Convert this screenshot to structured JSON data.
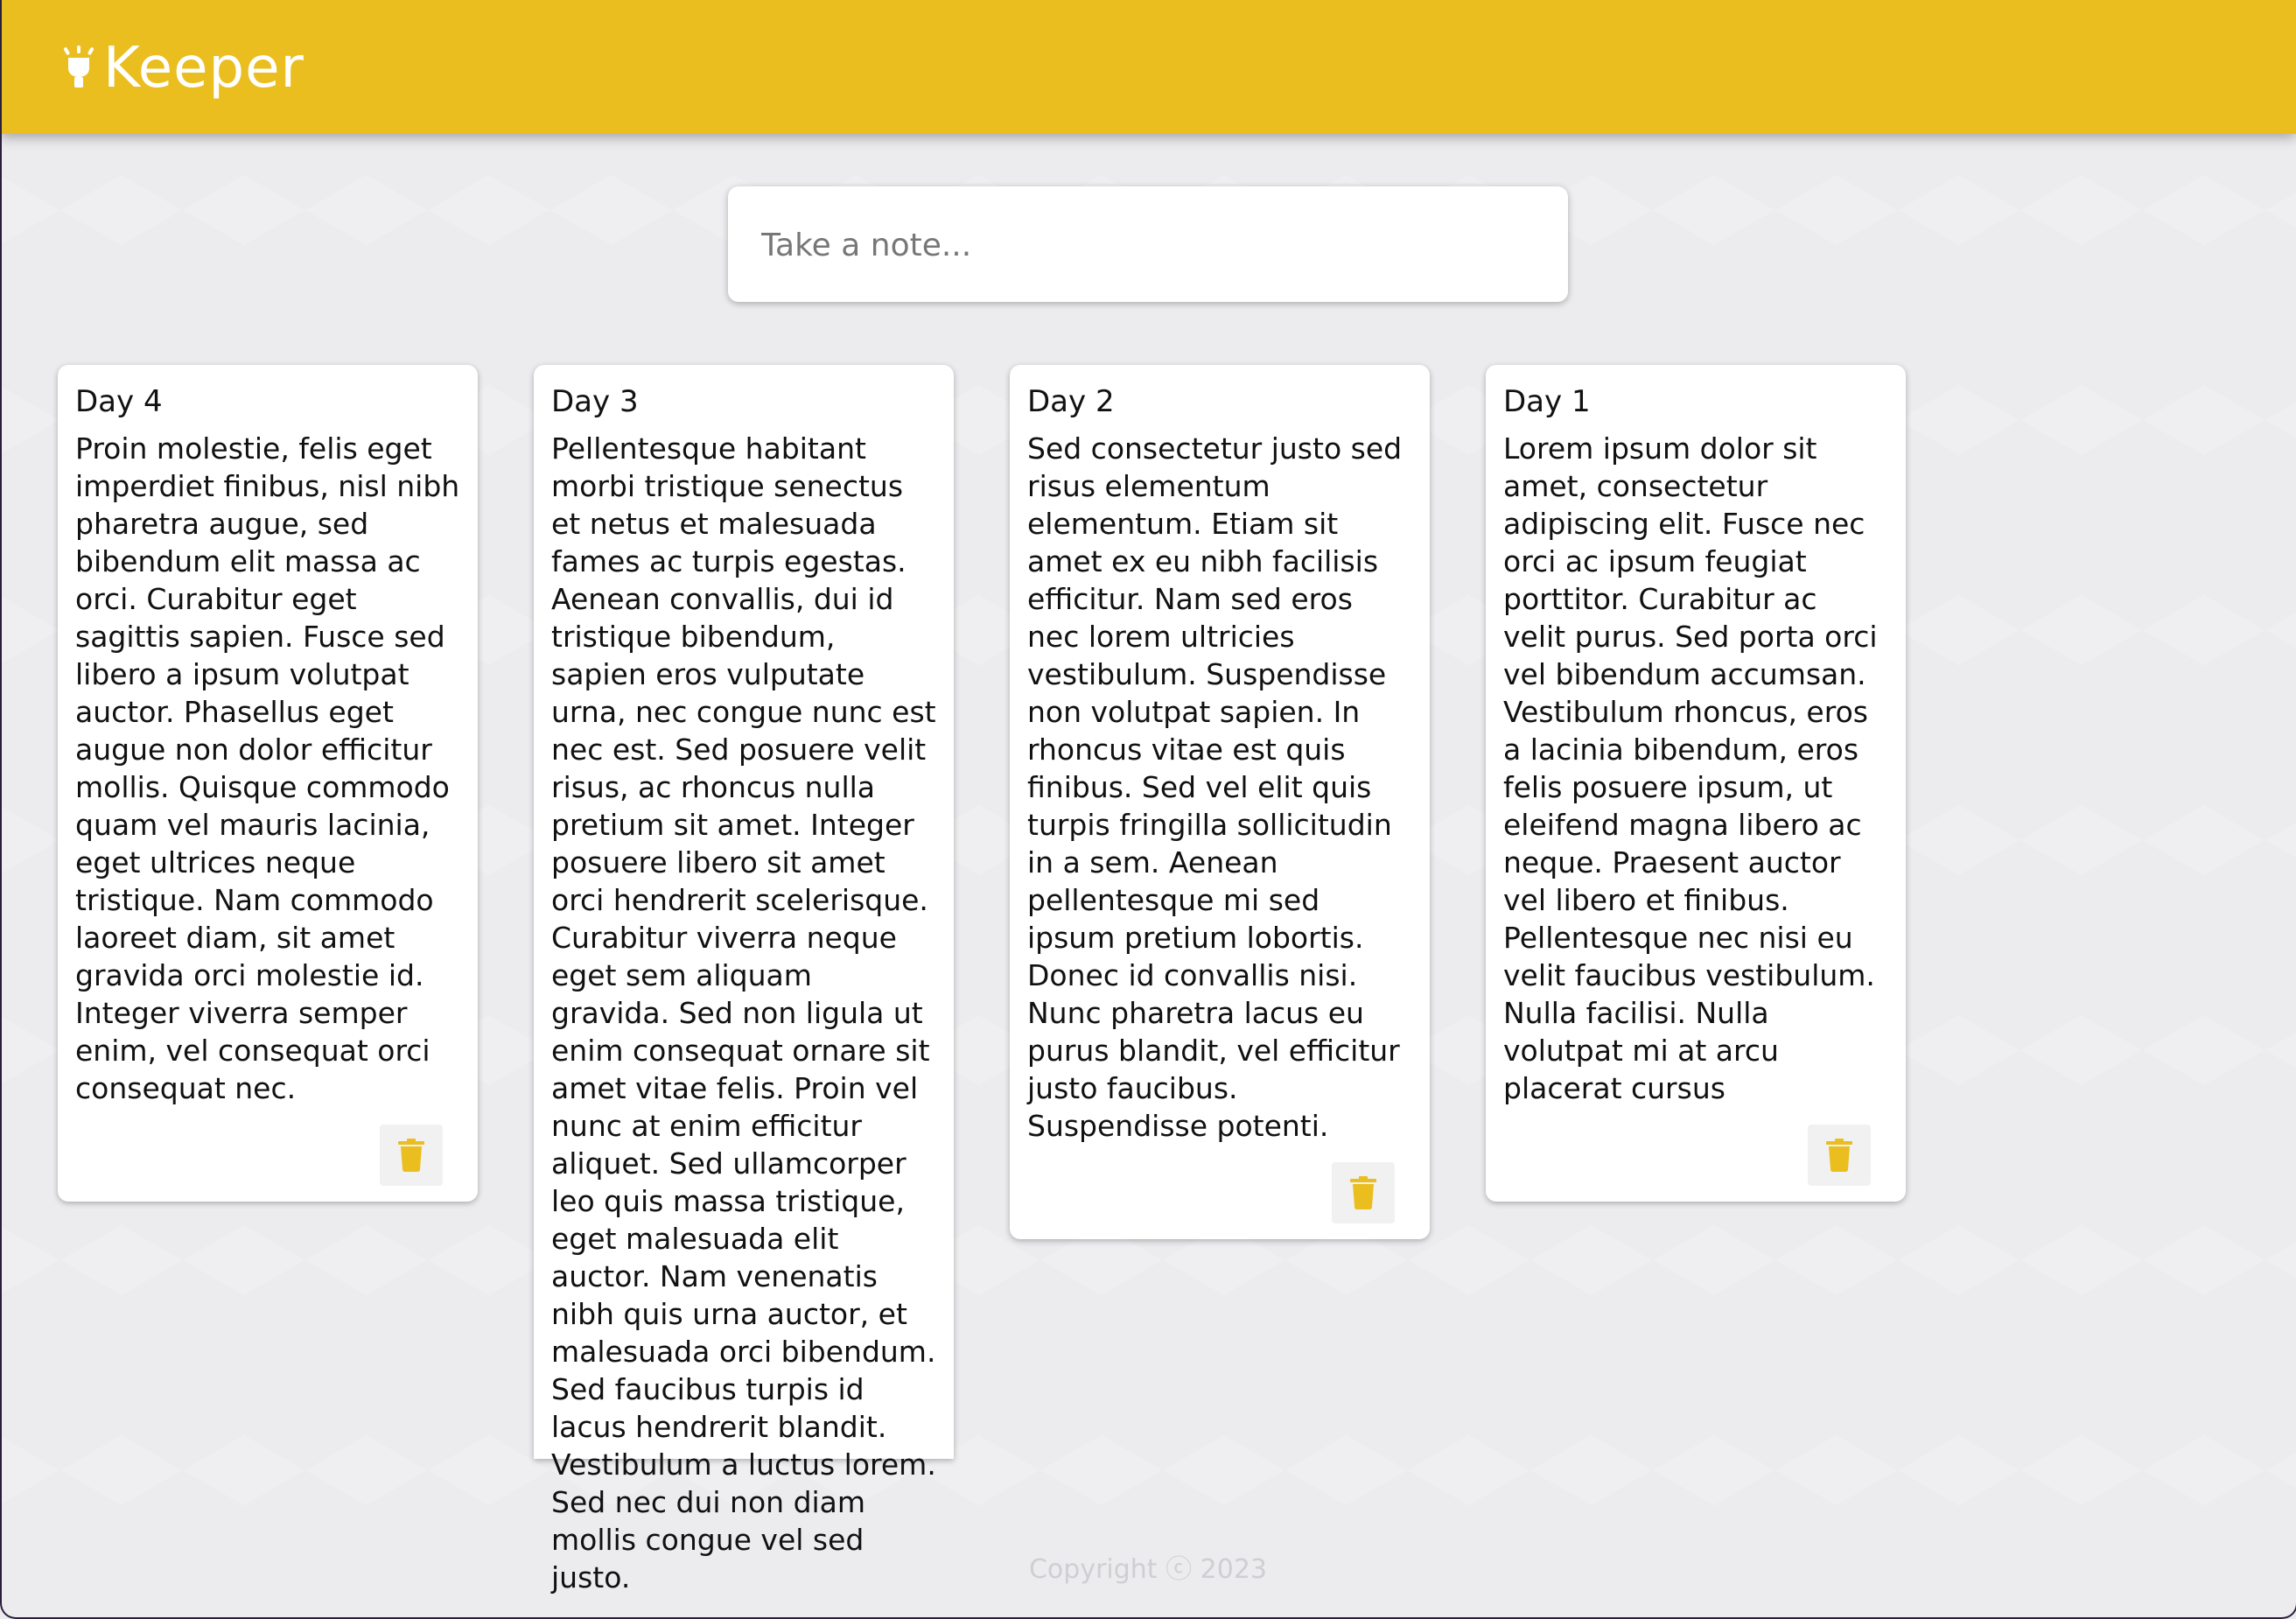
{
  "header": {
    "app_name": "Keeper",
    "logo_icon": "lightbulb-icon",
    "background_color": "#ebbe1f"
  },
  "create_area": {
    "placeholder": "Take a note..."
  },
  "notes": [
    {
      "title": "Day 4",
      "content": "Proin molestie, felis eget imperdiet finibus, nisl nibh pharetra augue, sed bibendum elit massa ac orci. Curabitur eget sagittis sapien. Fusce sed libero a ipsum volutpat auctor. Phasellus eget augue non dolor efficitur mollis. Quisque commodo quam vel mauris lacinia, eget ultrices neque tristique. Nam commodo laoreet diam, sit amet gravida orci molestie id. Integer viverra semper enim, vel consequat orci consequat nec.",
      "delete_icon": "trash-icon"
    },
    {
      "title": "Day 3",
      "content": "Pellentesque habitant morbi tristique senectus et netus et malesuada fames ac turpis egestas. Aenean convallis, dui id tristique bibendum, sapien eros vulputate urna, nec congue nunc est nec est. Sed posuere velit risus, ac rhoncus nulla pretium sit amet. Integer posuere libero sit amet orci hendrerit scelerisque. Curabitur viverra neque eget sem aliquam gravida. Sed non ligula ut enim consequat ornare sit amet vitae felis. Proin vel nunc at enim efficitur aliquet. Sed ullamcorper leo quis massa tristique, eget malesuada elit auctor. Nam venenatis nibh quis urna auctor, et malesuada orci bibendum. Sed faucibus turpis id lacus hendrerit blandit. Vestibulum a luctus lorem. Sed nec dui non diam mollis congue vel sed justo.",
      "delete_icon": "trash-icon"
    },
    {
      "title": "Day 2",
      "content": "Sed consectetur justo sed risus elementum elementum. Etiam sit amet ex eu nibh facilisis efficitur. Nam sed eros nec lorem ultricies vestibulum. Suspendisse non volutpat sapien. In rhoncus vitae est quis finibus. Sed vel elit quis turpis fringilla sollicitudin in a sem. Aenean pellentesque mi sed ipsum pretium lobortis. Donec id convallis nisi. Nunc pharetra lacus eu purus blandit, vel efficitur justo faucibus. Suspendisse potenti.",
      "delete_icon": "trash-icon"
    },
    {
      "title": "Day 1",
      "content": "Lorem ipsum dolor sit amet, consectetur adipiscing elit. Fusce nec orci ac ipsum feugiat porttitor. Curabitur ac velit purus. Sed porta orci vel bibendum accumsan. Vestibulum rhoncus, eros a lacinia bibendum, eros felis posuere ipsum, ut eleifend magna libero ac neque. Praesent auctor vel libero et finibus. Pellentesque nec nisi eu velit faucibus vestibulum. Nulla facilisi. Nulla volutpat mi at arcu placerat cursus",
      "delete_icon": "trash-icon"
    }
  ],
  "footer": {
    "copyright": "Copyright ⓒ 2023"
  }
}
